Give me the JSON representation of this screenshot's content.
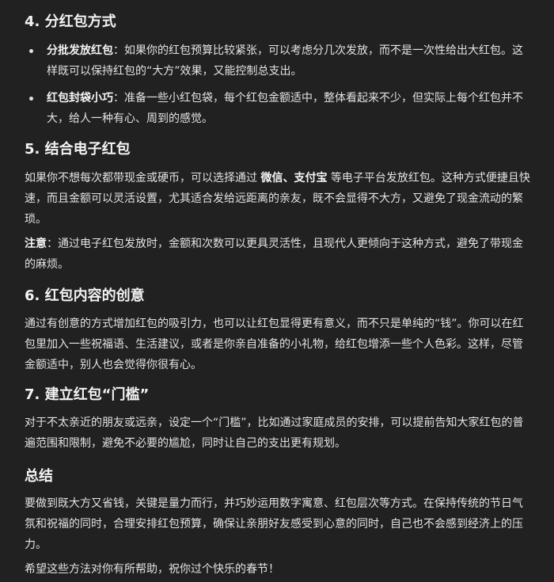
{
  "section4": {
    "heading": "4. 分红包方式",
    "items": [
      {
        "label": "分批发放红包",
        "text": "：如果你的红包预算比较紧张，可以考虑分几次发放，而不是一次性给出大红包。这样既可以保持红包的“大方”效果，又能控制总支出。"
      },
      {
        "label": "红包封袋小巧",
        "text": "：准备一些小红包袋，每个红包金额适中，整体看起来不少，但实际上每个红包并不大，给人一种有心、周到的感觉。"
      }
    ]
  },
  "section5": {
    "heading": "5. 结合电子红包",
    "para1": {
      "before": "如果你不想每次都带现金或硬币，可以选择通过 ",
      "bold1": "微信",
      "sep": "、",
      "bold2": "支付宝",
      "after": " 等电子平台发放红包。这种方式便捷且快速，而且金额可以灵活设置，尤其适合发给远距离的亲友，既不会显得不大方，又避免了现金流动的繁琐。"
    },
    "note": {
      "label": "注意",
      "text": "：通过电子红包发放时，金额和次数可以更具灵活性，且现代人更倾向于这种方式，避免了带现金的麻烦。"
    }
  },
  "section6": {
    "heading": "6. 红包内容的创意",
    "para": "通过有创意的方式增加红包的吸引力，也可以让红包显得更有意义，而不只是单纯的“钱”。你可以在红包里加入一些祝福语、生活建议，或者是你亲自准备的小礼物，给红包增添一些个人色彩。这样，尽管金额适中，别人也会觉得你很有心。"
  },
  "section7": {
    "heading": "7. 建立红包“门槛”",
    "para": "对于不太亲近的朋友或远亲，设定一个“门槛”，比如通过家庭成员的安排，可以提前告知大家红包的普遍范围和限制，避免不必要的尴尬，同时让自己的支出更有规划。"
  },
  "summary": {
    "heading": "总结",
    "para": "要做到既大方又省钱，关键是量力而行，并巧妙运用数字寓意、红包层次等方式。在保持传统的节日气氛和祝福的同时，合理安排红包预算，确保让亲朋好友感受到心意的同时，自己也不会感到经济上的压力。",
    "closing": "希望这些方法对你有所帮助，祝你过个快乐的春节！"
  }
}
